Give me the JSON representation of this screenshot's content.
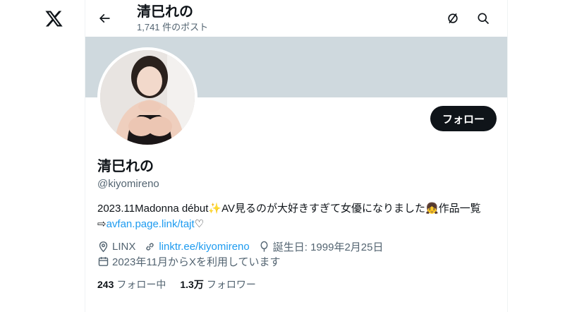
{
  "header": {
    "title": "清巳れの",
    "post_count": "1,741 件のポスト"
  },
  "profile": {
    "display_name": "清巳れの",
    "handle": "@kiyomireno",
    "follow_label": "フォロー",
    "bio_line1": "2023.11Madonna début",
    "bio_emoji1": "✨",
    "bio_line1b": "AV見るのが大好きすぎて女優になりました",
    "bio_emoji2": "👧",
    "bio_line1c": "作品一覧",
    "bio_arrow": "⇨",
    "bio_link": "avfan.page.link/tajt",
    "bio_heart": "♡",
    "location": "LINX",
    "website": "linktr.ee/kiyomireno",
    "birthday": "誕生日: 1999年2月25日",
    "joined": "2023年11月からXを利用しています",
    "following_count": "243",
    "following_label": "フォロー中",
    "followers_count": "1.3万",
    "followers_label": "フォロワー"
  },
  "icons": [
    "x-logo-icon",
    "back-arrow-icon",
    "no-notification-icon",
    "search-icon",
    "location-icon",
    "link-icon",
    "balloon-icon",
    "calendar-icon"
  ],
  "colors": {
    "accent": "#1d9bf0",
    "banner": "#cfd9de",
    "text": "#0f1419",
    "secondary": "#536471"
  }
}
